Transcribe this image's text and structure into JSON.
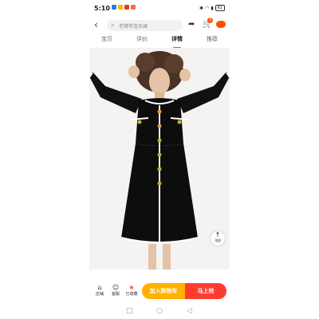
{
  "status_bar": {
    "time": "5:10",
    "battery": "61",
    "notif_icon_colors": [
      "#2a7be4",
      "#ffb400",
      "#e43a2a",
      "#ff6a3d"
    ]
  },
  "top_bar": {
    "search_placeholder": "老佛爷连衣裙",
    "cart_badge": "3"
  },
  "tabs": [
    {
      "label": "宝贝",
      "active": false
    },
    {
      "label": "评价",
      "active": false
    },
    {
      "label": "详情",
      "active": true
    },
    {
      "label": "推荐",
      "active": false
    }
  ],
  "product_image": {
    "subject": "black knit dress with white trim and gold buttons"
  },
  "back_to_top": {
    "label": "顶部"
  },
  "bottom_bar": {
    "shop_label": "店铺",
    "service_label": "客服",
    "favorite_label": "已收藏",
    "add_to_cart": "加入购物车",
    "buy_now": "马上抢"
  },
  "colors": {
    "accent": "#ff5000",
    "cart_button": "#ffb100",
    "buy_button": "#ff3b30"
  }
}
